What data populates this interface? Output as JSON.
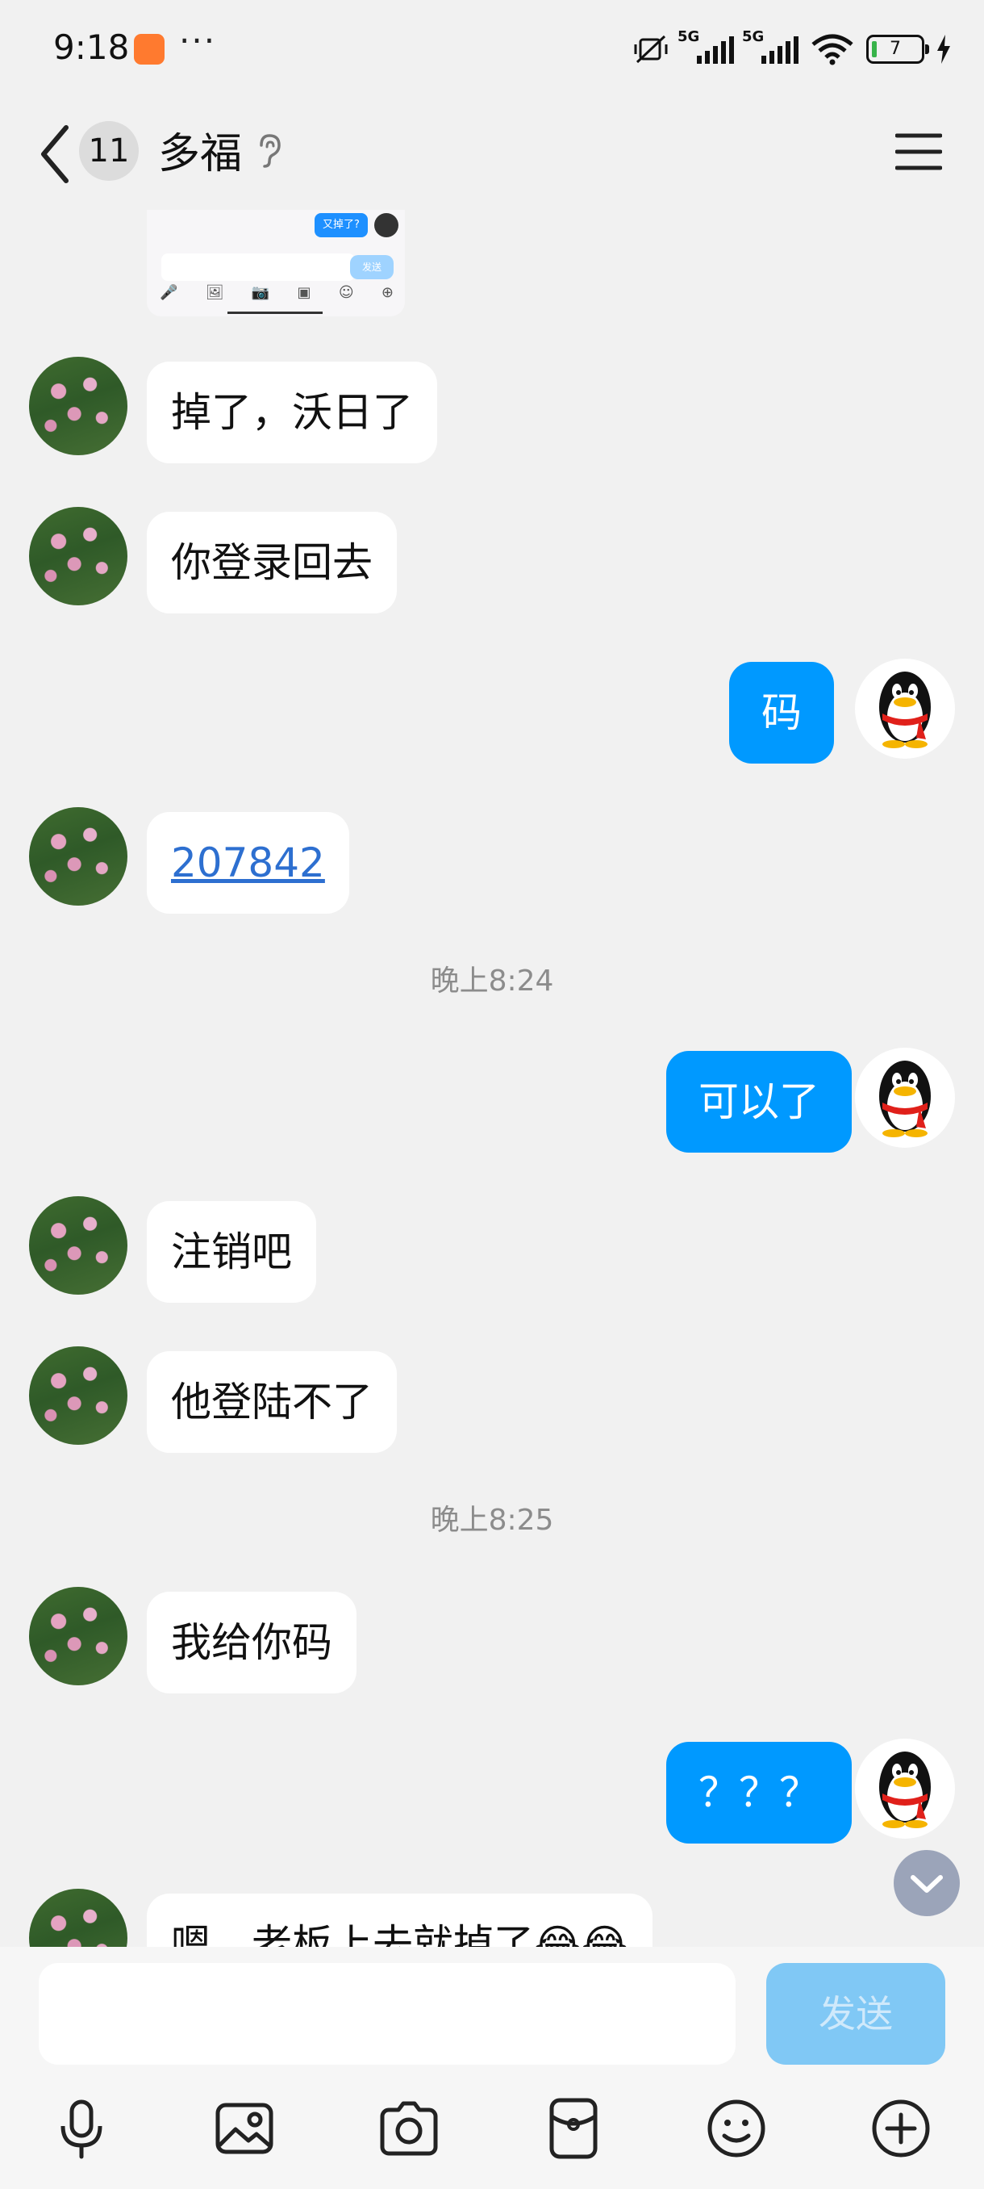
{
  "status_bar": {
    "time": "9:18",
    "more": "···",
    "network_1": "5G",
    "network_2": "5G",
    "battery": "7"
  },
  "header": {
    "unread_count": "11",
    "contact_name": "多福"
  },
  "thumbnail": {
    "bubble_text": "又掉了?",
    "send_text": "发送"
  },
  "messages": [
    {
      "side": "left",
      "text": "掉了，沃日了"
    },
    {
      "side": "left",
      "text": "你登录回去"
    },
    {
      "side": "right",
      "text": "码"
    },
    {
      "side": "left",
      "text": "207842",
      "link": true
    },
    {
      "type": "time",
      "text": "晚上8:24"
    },
    {
      "side": "right",
      "text": "可以了"
    },
    {
      "side": "left",
      "text": "注销吧"
    },
    {
      "side": "left",
      "text": "他登陆不了"
    },
    {
      "type": "time",
      "text": "晚上8:25"
    },
    {
      "side": "left",
      "text": "我给你码"
    },
    {
      "side": "right",
      "text": "？？？"
    },
    {
      "side": "left",
      "text": "嗯，老板上去就掉了😂😂"
    }
  ],
  "composer": {
    "value": "",
    "send_label": "发送"
  },
  "toolbar": [
    "mic-icon",
    "image-icon",
    "camera-icon",
    "red-packet-icon",
    "emoji-icon",
    "plus-icon"
  ],
  "colors": {
    "accent": "#0099ff",
    "background": "#f1f1f1",
    "send_disabled": "#80c8f5"
  }
}
